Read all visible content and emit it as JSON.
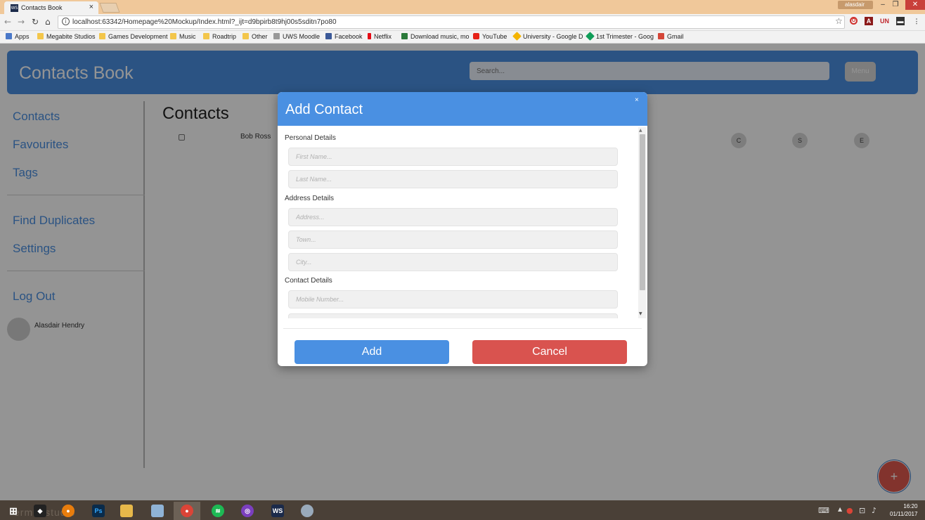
{
  "browser": {
    "tab_title": "Contacts Book",
    "tab_favicon": "WS",
    "tab_close": "×",
    "profile_name": "alasdair",
    "url": "localhost:63342/Homepage%20Mockup/Index.html?_ijt=d9bpirb8t9hj00s5sditn7po80",
    "bookmarks": [
      "Apps",
      "Megabite Studios",
      "Games Development",
      "Music",
      "Roadtrip",
      "Other",
      "UWS Moodle",
      "Facebook",
      "Netflix",
      "Download music, mo",
      "YouTube",
      "University - Google D",
      "1st Trimester - Goog",
      "Gmail"
    ]
  },
  "app": {
    "title": "Contacts Book",
    "search_placeholder": "Search...",
    "menu_label": "Menu"
  },
  "sidebar": {
    "items": [
      "Contacts",
      "Favourites",
      "Tags",
      "Find Duplicates",
      "Settings",
      "Log Out"
    ],
    "user_name": "Alasdair Hendry"
  },
  "main": {
    "title": "Contacts",
    "contacts": [
      {
        "name": "Bob Ross"
      }
    ],
    "action_circles": [
      "C",
      "S",
      "E"
    ],
    "fab_label": "+"
  },
  "modal": {
    "title": "Add Contact",
    "close_label": "×",
    "sections": {
      "personal": "Personal Details",
      "address": "Address Details",
      "contact": "Contact Details"
    },
    "fields": {
      "first_name": "First Name...",
      "last_name": "Last Name...",
      "address": "Address...",
      "town": "Town...",
      "city": "City...",
      "mobile": "Mobile Number..."
    },
    "add_label": "Add",
    "cancel_label": "Cancel"
  },
  "taskbar": {
    "wallpaper_text": "ermic studio",
    "time": "16:20",
    "date": "01/11/2017"
  },
  "colors": {
    "primary": "#4a90e2",
    "danger": "#d9534f",
    "fab": "#e0584f"
  }
}
